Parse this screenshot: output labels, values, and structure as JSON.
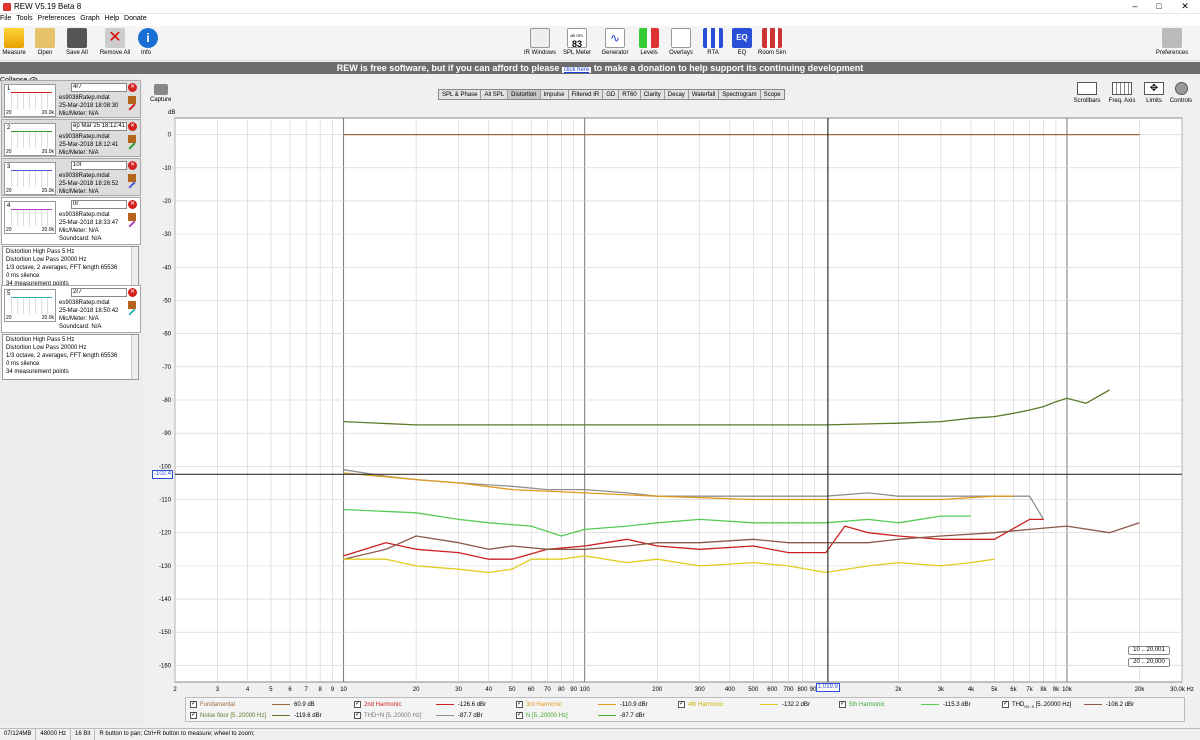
{
  "window": {
    "title": "REW V5.19 Beta 8"
  },
  "menu": [
    "File",
    "Tools",
    "Preferences",
    "Graph",
    "Help",
    "Donate"
  ],
  "toolbar": {
    "left": [
      "Measure",
      "Open",
      "Save All",
      "Remove All",
      "Info"
    ],
    "center": [
      "IR Windows",
      "SPL Meter",
      "Generator",
      "Levels",
      "Overlays",
      "RTA",
      "EQ",
      "Room Sim"
    ],
    "spl_value": "83",
    "spl_caption": "dB SPL",
    "right": "Preferences"
  },
  "banner": {
    "pre": "REW is free software, but if you can afford to please ",
    "link": "click here",
    "post": " to make a donation to help support its continuing development"
  },
  "sidebar": {
    "collapse": "Collapse",
    "measurements": [
      {
        "idx": "1",
        "name": "4r7",
        "file": "es9038Ratep.mdat",
        "date": "25-Mar-2018 18:08:30",
        "mic": "Mic/Meter: N/A",
        "color": "#d42020"
      },
      {
        "idx": "2",
        "name": "ep Mar 25 18:12:41",
        "file": "es9038Ratep.mdat",
        "date": "25-Mar-2018 18:12:41",
        "mic": "Mic/Meter: N/A",
        "color": "#2a9a2a"
      },
      {
        "idx": "3",
        "name": "10r",
        "file": "es9038Ratep.mdat",
        "date": "25-Mar-2018 18:26:52",
        "mic": "Mic/Meter: N/A",
        "color": "#4a5ad8"
      },
      {
        "idx": "4",
        "name": "0r",
        "file": "es9038Ratep.mdat",
        "date": "25-Mar-2018 18:33:47",
        "mic": "Mic/Meter: N/A",
        "sound": "Soundcard: N/A",
        "color": "#b040c0"
      },
      {
        "idx": "5",
        "name": "2r7",
        "file": "es9038Ratep.mdat",
        "date": "25-Mar-2018 18:50:42",
        "mic": "Mic/Meter: N/A",
        "sound": "Soundcard: N/A",
        "color": "#30b0b0"
      }
    ],
    "thumb_axis": [
      "20",
      "20.0k"
    ],
    "notes": [
      "Distortion High Pass 5 Hz",
      "Distortion Low Pass 20000 Hz",
      "1/3 octave, 2 averages, FFT length 65536",
      "0 ms silence",
      "34 measurement points"
    ]
  },
  "capture": "Capture",
  "graph_tabs": [
    "SPL & Phase",
    "All SPL",
    "Distortion",
    "Impulse",
    "Filtered IR",
    "GD",
    "RT60",
    "Clarity",
    "Decay",
    "Waterfall",
    "Spectrogram",
    "Scope"
  ],
  "active_tab": "Distortion",
  "right_tools": [
    "Scrollbars",
    "Freq. Axis",
    "Limits",
    "Controls"
  ],
  "cursor": {
    "y_readout": "-102.4",
    "x_readout": "1,019.9"
  },
  "zoom_buttons": [
    "10 .. 20,001",
    "20 .. 20,000"
  ],
  "chart_data": {
    "type": "line",
    "ylabel": "dB",
    "xscale": "log",
    "xlim": [
      2,
      30000
    ],
    "ylim": [
      -165,
      5
    ],
    "yticks": [
      "0",
      "-10",
      "-20",
      "-30",
      "-40",
      "-50",
      "-60",
      "-70",
      "-80",
      "-90",
      "-100",
      "-110",
      "-120",
      "-130",
      "-140",
      "-150",
      "-160"
    ],
    "xticks": [
      {
        "v": 2,
        "t": "2"
      },
      {
        "v": 3,
        "t": "3"
      },
      {
        "v": 4,
        "t": "4"
      },
      {
        "v": 5,
        "t": "5"
      },
      {
        "v": 6,
        "t": "6"
      },
      {
        "v": 7,
        "t": "7"
      },
      {
        "v": 8,
        "t": "8"
      },
      {
        "v": 9,
        "t": "9"
      },
      {
        "v": 10,
        "t": "10"
      },
      {
        "v": 20,
        "t": "20"
      },
      {
        "v": 30,
        "t": "30"
      },
      {
        "v": 40,
        "t": "40"
      },
      {
        "v": 50,
        "t": "50"
      },
      {
        "v": 60,
        "t": "60"
      },
      {
        "v": 70,
        "t": "70"
      },
      {
        "v": 80,
        "t": "80"
      },
      {
        "v": 90,
        "t": "90"
      },
      {
        "v": 100,
        "t": "100"
      },
      {
        "v": 200,
        "t": "200"
      },
      {
        "v": 300,
        "t": "300"
      },
      {
        "v": 400,
        "t": "400"
      },
      {
        "v": 500,
        "t": "500"
      },
      {
        "v": 600,
        "t": "600"
      },
      {
        "v": 700,
        "t": "700"
      },
      {
        "v": 800,
        "t": "800"
      },
      {
        "v": 900,
        "t": "900"
      },
      {
        "v": 2000,
        "t": "2k"
      },
      {
        "v": 3000,
        "t": "3k"
      },
      {
        "v": 4000,
        "t": "4k"
      },
      {
        "v": 5000,
        "t": "5k"
      },
      {
        "v": 6000,
        "t": "6k"
      },
      {
        "v": 7000,
        "t": "7k"
      },
      {
        "v": 8000,
        "t": "8k"
      },
      {
        "v": 9000,
        "t": "9k"
      },
      {
        "v": 10000,
        "t": "10k"
      },
      {
        "v": 20000,
        "t": "20k"
      },
      {
        "v": 30000,
        "t": "30.0k Hz"
      }
    ],
    "cursor_x": 1020,
    "cursor_y": -102.4,
    "series": [
      {
        "name": "Fundamental",
        "color": "#9a6a3a",
        "x": [
          10,
          20000
        ],
        "y": [
          0,
          0
        ]
      },
      {
        "name": "Noise floor [5..20000 Hz]",
        "color": "#5a7a2a",
        "x": [
          10,
          20,
          50,
          100,
          200,
          500,
          1000,
          2000,
          3000,
          4000,
          5000,
          6000,
          7000,
          8000,
          9000,
          10000,
          12000,
          15000
        ],
        "y": [
          -86.5,
          -87.5,
          -87.5,
          -87.5,
          -87.5,
          -87.5,
          -87.5,
          -87.0,
          -86.5,
          -85.5,
          -85.0,
          -84.0,
          -83.0,
          -82.0,
          -80.5,
          -79.5,
          -81.0,
          -77.0
        ]
      },
      {
        "name": "THD+N [5..20000 Hz]",
        "color": "#909090",
        "x": [
          10,
          15,
          20,
          30,
          50,
          70,
          100,
          150,
          200,
          300,
          500,
          700,
          1000,
          1500,
          2000,
          3000,
          5000,
          7000,
          8000
        ],
        "y": [
          -101,
          -103,
          -104,
          -105,
          -106,
          -107,
          -107,
          -108,
          -109,
          -109,
          -109,
          -109,
          -109,
          -108,
          -109,
          -109,
          -109,
          -109,
          -116
        ]
      },
      {
        "name": "3rd Harmonic",
        "color": "#e09a20",
        "x": [
          10,
          20,
          30,
          50,
          100,
          200,
          500,
          1000,
          2000,
          3000,
          5000,
          6000
        ],
        "y": [
          -102,
          -104,
          -105,
          -107,
          -108,
          -109,
          -110,
          -110,
          -110,
          -110,
          -109,
          -109
        ]
      },
      {
        "name": "5th Harmonic",
        "color": "#55cc55",
        "x": [
          10,
          20,
          30,
          40,
          60,
          80,
          100,
          150,
          200,
          300,
          500,
          700,
          1000,
          1500,
          2000,
          3000,
          4000
        ],
        "y": [
          -113,
          -114,
          -116,
          -117,
          -118,
          -121,
          -119,
          -118,
          -117,
          -116,
          -117,
          -117,
          -117,
          -116,
          -117,
          -115,
          -115
        ]
      },
      {
        "name": "2nd Harmonic",
        "color": "#cc2020",
        "x": [
          10,
          15,
          20,
          30,
          40,
          50,
          70,
          100,
          150,
          200,
          300,
          500,
          700,
          1000,
          1200,
          1500,
          2000,
          3000,
          5000,
          7000,
          8000
        ],
        "y": [
          -127,
          -123,
          -125,
          -126,
          -128,
          -128,
          -125,
          -124,
          -122,
          -124,
          -125,
          -124,
          -126,
          -126,
          -118,
          -120,
          -121,
          -122,
          -122,
          -116,
          -116
        ]
      },
      {
        "name": "THD",
        "color": "#8a5a4a",
        "x": [
          10,
          15,
          20,
          30,
          40,
          50,
          70,
          100,
          150,
          200,
          300,
          500,
          700,
          1000,
          1500,
          2000,
          3000,
          5000,
          7000,
          10000,
          15000,
          20000
        ],
        "y": [
          -128,
          -125,
          -121,
          -123,
          -125,
          -124,
          -125,
          -125,
          -124,
          -123,
          -123,
          -122,
          -123,
          -123,
          -123,
          -122,
          -121,
          -120,
          -119,
          -118,
          -120,
          -117
        ]
      },
      {
        "name": "4th Harmonic",
        "color": "#e0cc20",
        "x": [
          10,
          15,
          20,
          30,
          40,
          50,
          60,
          80,
          100,
          150,
          200,
          300,
          500,
          700,
          1000,
          1500,
          2000,
          3000,
          4000,
          5000
        ],
        "y": [
          -128,
          -128,
          -130,
          -131,
          -132,
          -131,
          -128,
          -128,
          -127,
          -129,
          -128,
          -130,
          -129,
          -130,
          -132,
          -130,
          -129,
          -130,
          -129,
          -128
        ]
      },
      {
        "name": "N [5..20000 Hz]",
        "color": "#4aaa2a",
        "x": [],
        "y": []
      }
    ]
  },
  "legend": [
    {
      "name": "Fundamental",
      "color": "#9a6a3a",
      "value": "60.9 dB"
    },
    {
      "name": "2nd Harmonic",
      "color": "#cc2020",
      "value": "-126.6 dBr"
    },
    {
      "name": "3rd Harmonic",
      "color": "#e09a20",
      "value": "-110.9 dBr"
    },
    {
      "name": "4th Harmonic",
      "color": "#e0cc20",
      "value": "-132.2 dBr"
    },
    {
      "name": "5th Harmonic",
      "color": "#55cc55",
      "value": "-115.3 dBr"
    },
    {
      "name": "THD",
      "sub": "H2..9",
      "tail": " [5..20000 Hz]",
      "color": "#8a5a4a",
      "value": "-108.2 dBr"
    },
    {
      "name": "Noise floor [5..20000 Hz]",
      "color": "#5a7a2a",
      "value": "-119.6 dBr"
    },
    {
      "name": "THD+N [5..20000 Hz]",
      "color": "#909090",
      "value": "-87.7 dBr"
    },
    {
      "name": "N [5..20000 Hz]",
      "color": "#4aaa2a",
      "value": "-87.7 dBr"
    }
  ],
  "status": [
    "07/124MB",
    "48000 Hz",
    "16 Bit",
    "R button to pan; Ctrl+R button to measure; wheel to zoom;"
  ]
}
